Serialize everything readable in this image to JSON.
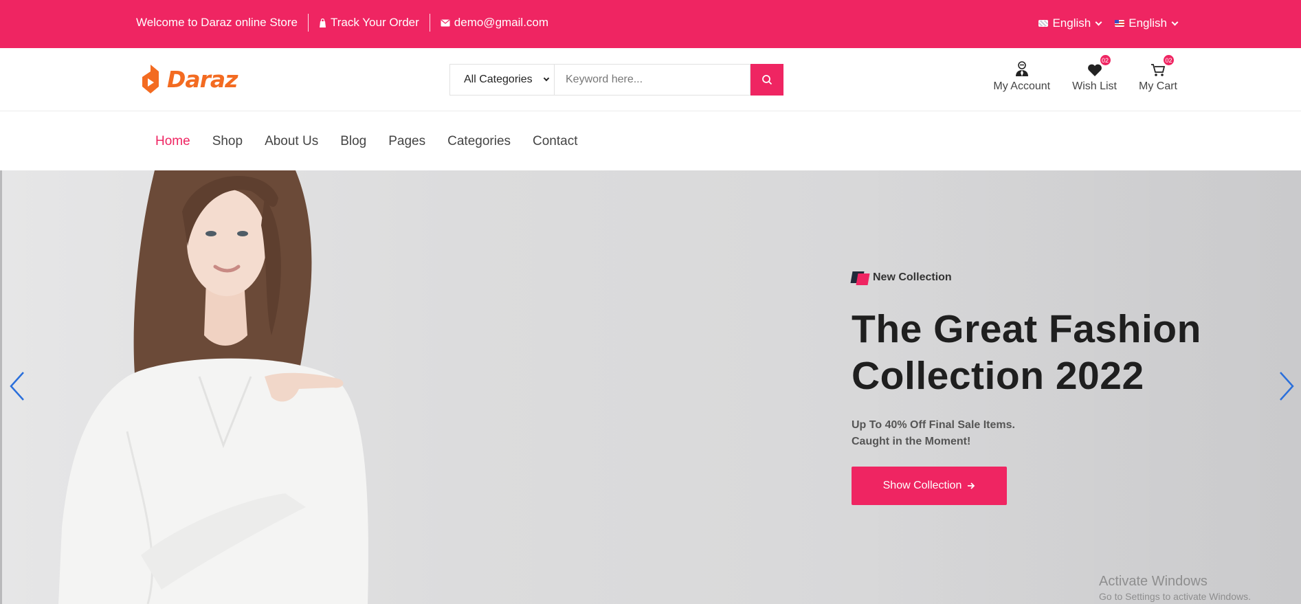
{
  "topbar": {
    "welcome": "Welcome to Daraz online Store",
    "track_order": "Track Your Order",
    "email": "demo@gmail.com",
    "language_1": "English",
    "language_2": "English",
    "bg_color": "#ef2562"
  },
  "header": {
    "logo_text": "Daraz",
    "search": {
      "category": "All Categories",
      "placeholder": "Keyword here..."
    },
    "actions": {
      "account_label": "My Account",
      "wishlist_label": "Wish List",
      "wishlist_count": "02",
      "cart_label": "My Cart",
      "cart_count": "02"
    }
  },
  "nav": {
    "items": [
      "Home",
      "Shop",
      "About Us",
      "Blog",
      "Pages",
      "Categories",
      "Contact"
    ],
    "active": "Home"
  },
  "hero": {
    "tag": "New Collection",
    "title_line1": "The Great Fashion",
    "title_line2": "Collection 2022",
    "subtitle_line1": "Up To 40% Off Final Sale Items.",
    "subtitle_line2": "Caught in the Moment!",
    "button_label": "Show Collection",
    "accent_color": "#ef2562"
  },
  "watermark": {
    "line1": "Activate Windows",
    "line2": "Go to Settings to activate Windows."
  },
  "icons": [
    "store-icon",
    "mail-icon",
    "flag-uk-icon",
    "flag-us-icon",
    "chevron-down-icon",
    "search-icon",
    "user-icon",
    "heart-icon",
    "cart-icon",
    "arrow-right-icon",
    "chevron-left-icon",
    "chevron-right-icon"
  ]
}
